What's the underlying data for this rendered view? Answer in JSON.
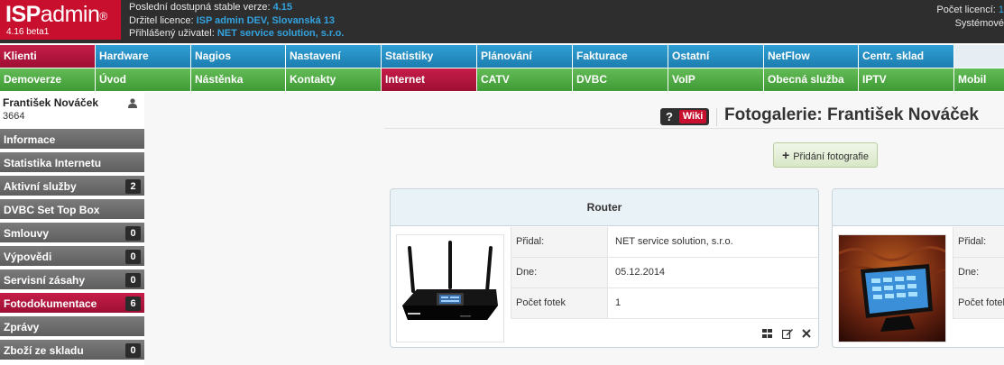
{
  "header": {
    "logo_text": "ISP",
    "logo_text2": "admin",
    "logo_reg": "®",
    "version": "4.16 beta1",
    "stable_label": "Poslední dostupná stable verze: ",
    "stable_value": "4.15",
    "license_label": "Držitel licence: ",
    "license_value": "ISP admin DEV, Slovanská 13",
    "user_label": "Přihlášený uživatel: ",
    "user_value": "NET service solution, s.r.o.",
    "licence_count_label": "Počet licencí: ",
    "licence_count_value": "1",
    "system_label": "Systémové"
  },
  "menu_top": [
    "Klienti",
    "Hardware",
    "Nagios",
    "Nastavení",
    "Statistiky",
    "Plánování",
    "Fakturace",
    "Ostatní",
    "NetFlow",
    "Centr. sklad"
  ],
  "menu_bottom": [
    "Demoverze",
    "Úvod",
    "Nástěnka",
    "Kontakty",
    "Internet",
    "CATV",
    "DVBC",
    "VoIP",
    "Obecná služba",
    "IPTV",
    "Mobil"
  ],
  "client": {
    "name": "František Nováček",
    "id": "3664"
  },
  "sidebar": [
    {
      "label": "Informace",
      "badge": ""
    },
    {
      "label": "Statistika Internetu",
      "badge": ""
    },
    {
      "label": "Aktivní služby",
      "badge": "2"
    },
    {
      "label": "DVBC Set Top Box",
      "badge": ""
    },
    {
      "label": "Smlouvy",
      "badge": "0"
    },
    {
      "label": "Výpovědi",
      "badge": "0"
    },
    {
      "label": "Servisní zásahy",
      "badge": "0"
    },
    {
      "label": "Fotodokumentace",
      "badge": "6"
    },
    {
      "label": "Zprávy",
      "badge": ""
    },
    {
      "label": "Zboží ze skladu",
      "badge": "0"
    }
  ],
  "page": {
    "wiki_q": "?",
    "wiki_label": "Wiki",
    "title": "Fotogalerie: František Nováček",
    "add_button": "Přidání fotografie"
  },
  "gallery": [
    {
      "title": "Router",
      "added_by_label": "Přidal:",
      "added_by": "NET service solution, s.r.o.",
      "date_label": "Dne:",
      "date": "05.12.2014",
      "count_label": "Počet fotek",
      "count": "1"
    },
    {
      "title": "",
      "added_by_label": "Přidal:",
      "added_by": "",
      "date_label": "Dne:",
      "date": "",
      "count_label": "Počet fotek",
      "count": ""
    }
  ],
  "colors": {
    "brand_red": "#c8102e",
    "menu_blue": "#1d7db0",
    "menu_green": "#3f9b35",
    "sidebar_gray": "#5e5e5e",
    "link_blue": "#33a3e0"
  }
}
